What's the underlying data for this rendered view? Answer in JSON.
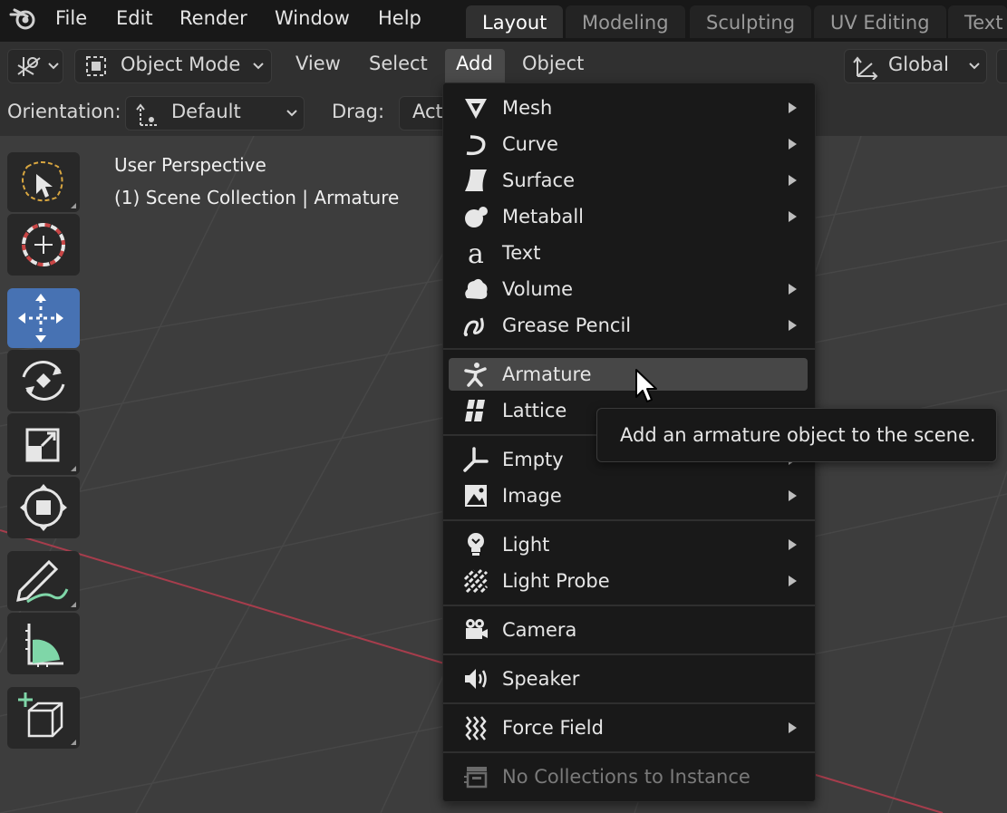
{
  "topbar": {
    "menus": [
      "File",
      "Edit",
      "Render",
      "Window",
      "Help"
    ],
    "workspaces": [
      "Layout",
      "Modeling",
      "Sculpting",
      "UV Editing",
      "Text"
    ],
    "active_workspace": "Layout"
  },
  "header": {
    "mode": "Object Mode",
    "menus": [
      "View",
      "Select",
      "Add",
      "Object"
    ],
    "transform_orientation": "Global"
  },
  "tool_header": {
    "orientation_label": "Orientation:",
    "orientation_value": "Default",
    "drag_label": "Drag:",
    "drag_value": "Act"
  },
  "viewport": {
    "perspective": "User Perspective",
    "collection": "(1) Scene Collection | Armature"
  },
  "toolbar": {
    "tools": [
      "select-box",
      "cursor",
      "move",
      "rotate",
      "scale",
      "transform",
      "annotate",
      "measure",
      "add-cube"
    ],
    "active_tool": "move"
  },
  "add_menu": {
    "items": [
      {
        "label": "Mesh",
        "icon": "mesh-icon",
        "submenu": true
      },
      {
        "label": "Curve",
        "icon": "curve-icon",
        "submenu": true
      },
      {
        "label": "Surface",
        "icon": "surface-icon",
        "submenu": true
      },
      {
        "label": "Metaball",
        "icon": "metaball-icon",
        "submenu": true
      },
      {
        "label": "Text",
        "icon": "text-icon",
        "submenu": false
      },
      {
        "label": "Volume",
        "icon": "volume-icon",
        "submenu": true
      },
      {
        "label": "Grease Pencil",
        "icon": "grease-pencil-icon",
        "submenu": true
      },
      {
        "label": "Armature",
        "icon": "armature-icon",
        "submenu": false,
        "highlighted": true
      },
      {
        "label": "Lattice",
        "icon": "lattice-icon",
        "submenu": false
      },
      {
        "label": "Empty",
        "icon": "empty-icon",
        "submenu": true
      },
      {
        "label": "Image",
        "icon": "image-icon",
        "submenu": true
      },
      {
        "label": "Light",
        "icon": "light-icon",
        "submenu": true
      },
      {
        "label": "Light Probe",
        "icon": "light-probe-icon",
        "submenu": true
      },
      {
        "label": "Camera",
        "icon": "camera-icon",
        "submenu": false
      },
      {
        "label": "Speaker",
        "icon": "speaker-icon",
        "submenu": false
      },
      {
        "label": "Force Field",
        "icon": "force-field-icon",
        "submenu": true
      },
      {
        "label": "No Collections to Instance",
        "icon": "collection-instance-icon",
        "submenu": false,
        "disabled": true
      }
    ]
  },
  "tooltip": {
    "text": "Add an armature object to the scene."
  },
  "colors": {
    "accent": "#4772b3",
    "menu_bg": "#191919",
    "highlight": "#474747",
    "x_axis": "#a63d4c"
  }
}
